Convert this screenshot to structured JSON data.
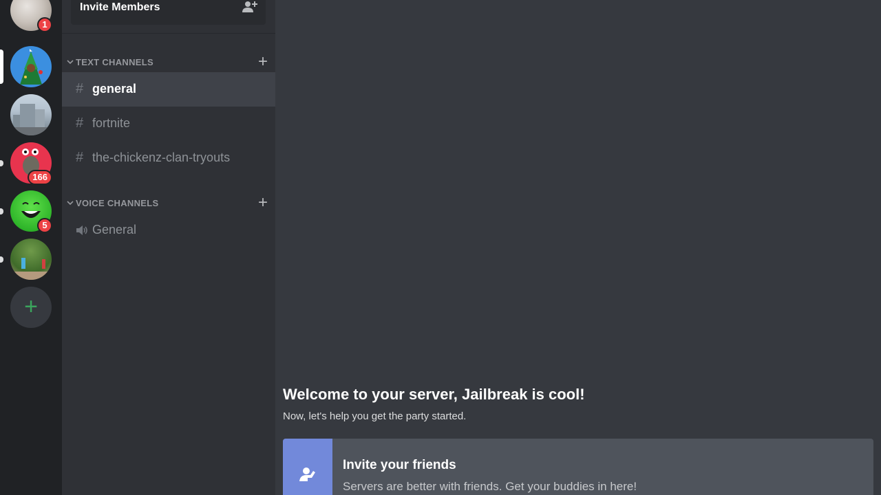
{
  "server_rail": {
    "servers": [
      {
        "name": "server-1",
        "badge": "1"
      },
      {
        "name": "server-christmas-tree"
      },
      {
        "name": "server-city"
      },
      {
        "name": "server-red",
        "badge": "166"
      },
      {
        "name": "server-green",
        "badge": "5"
      },
      {
        "name": "server-trees"
      }
    ],
    "add_server_icon": "plus-icon"
  },
  "sidebar": {
    "invite_label": "Invite Members",
    "invite_icon": "add-user-icon",
    "text_category": "TEXT CHANNELS",
    "voice_category": "VOICE CHANNELS",
    "text_channels": [
      {
        "name": "general",
        "active": true
      },
      {
        "name": "fortnite"
      },
      {
        "name": "the-chickenz-clan-tryouts"
      }
    ],
    "voice_channels": [
      {
        "name": "General"
      }
    ],
    "hash_symbol": "#",
    "add_symbol": "+"
  },
  "main": {
    "welcome_title": "Welcome to your server, Jailbreak is cool!",
    "welcome_subtitle": "Now, let's help you get the party started.",
    "card": {
      "title": "Invite your friends",
      "text": "Servers are better with friends. Get your buddies in here!",
      "icon": "wave-icon"
    }
  },
  "colors": {
    "accent": "#7289da",
    "rail_bg": "#202225",
    "sidebar_bg": "#2f3136",
    "main_bg": "#36393f",
    "badge": "#ed4245",
    "add_green": "#3ba55d"
  }
}
